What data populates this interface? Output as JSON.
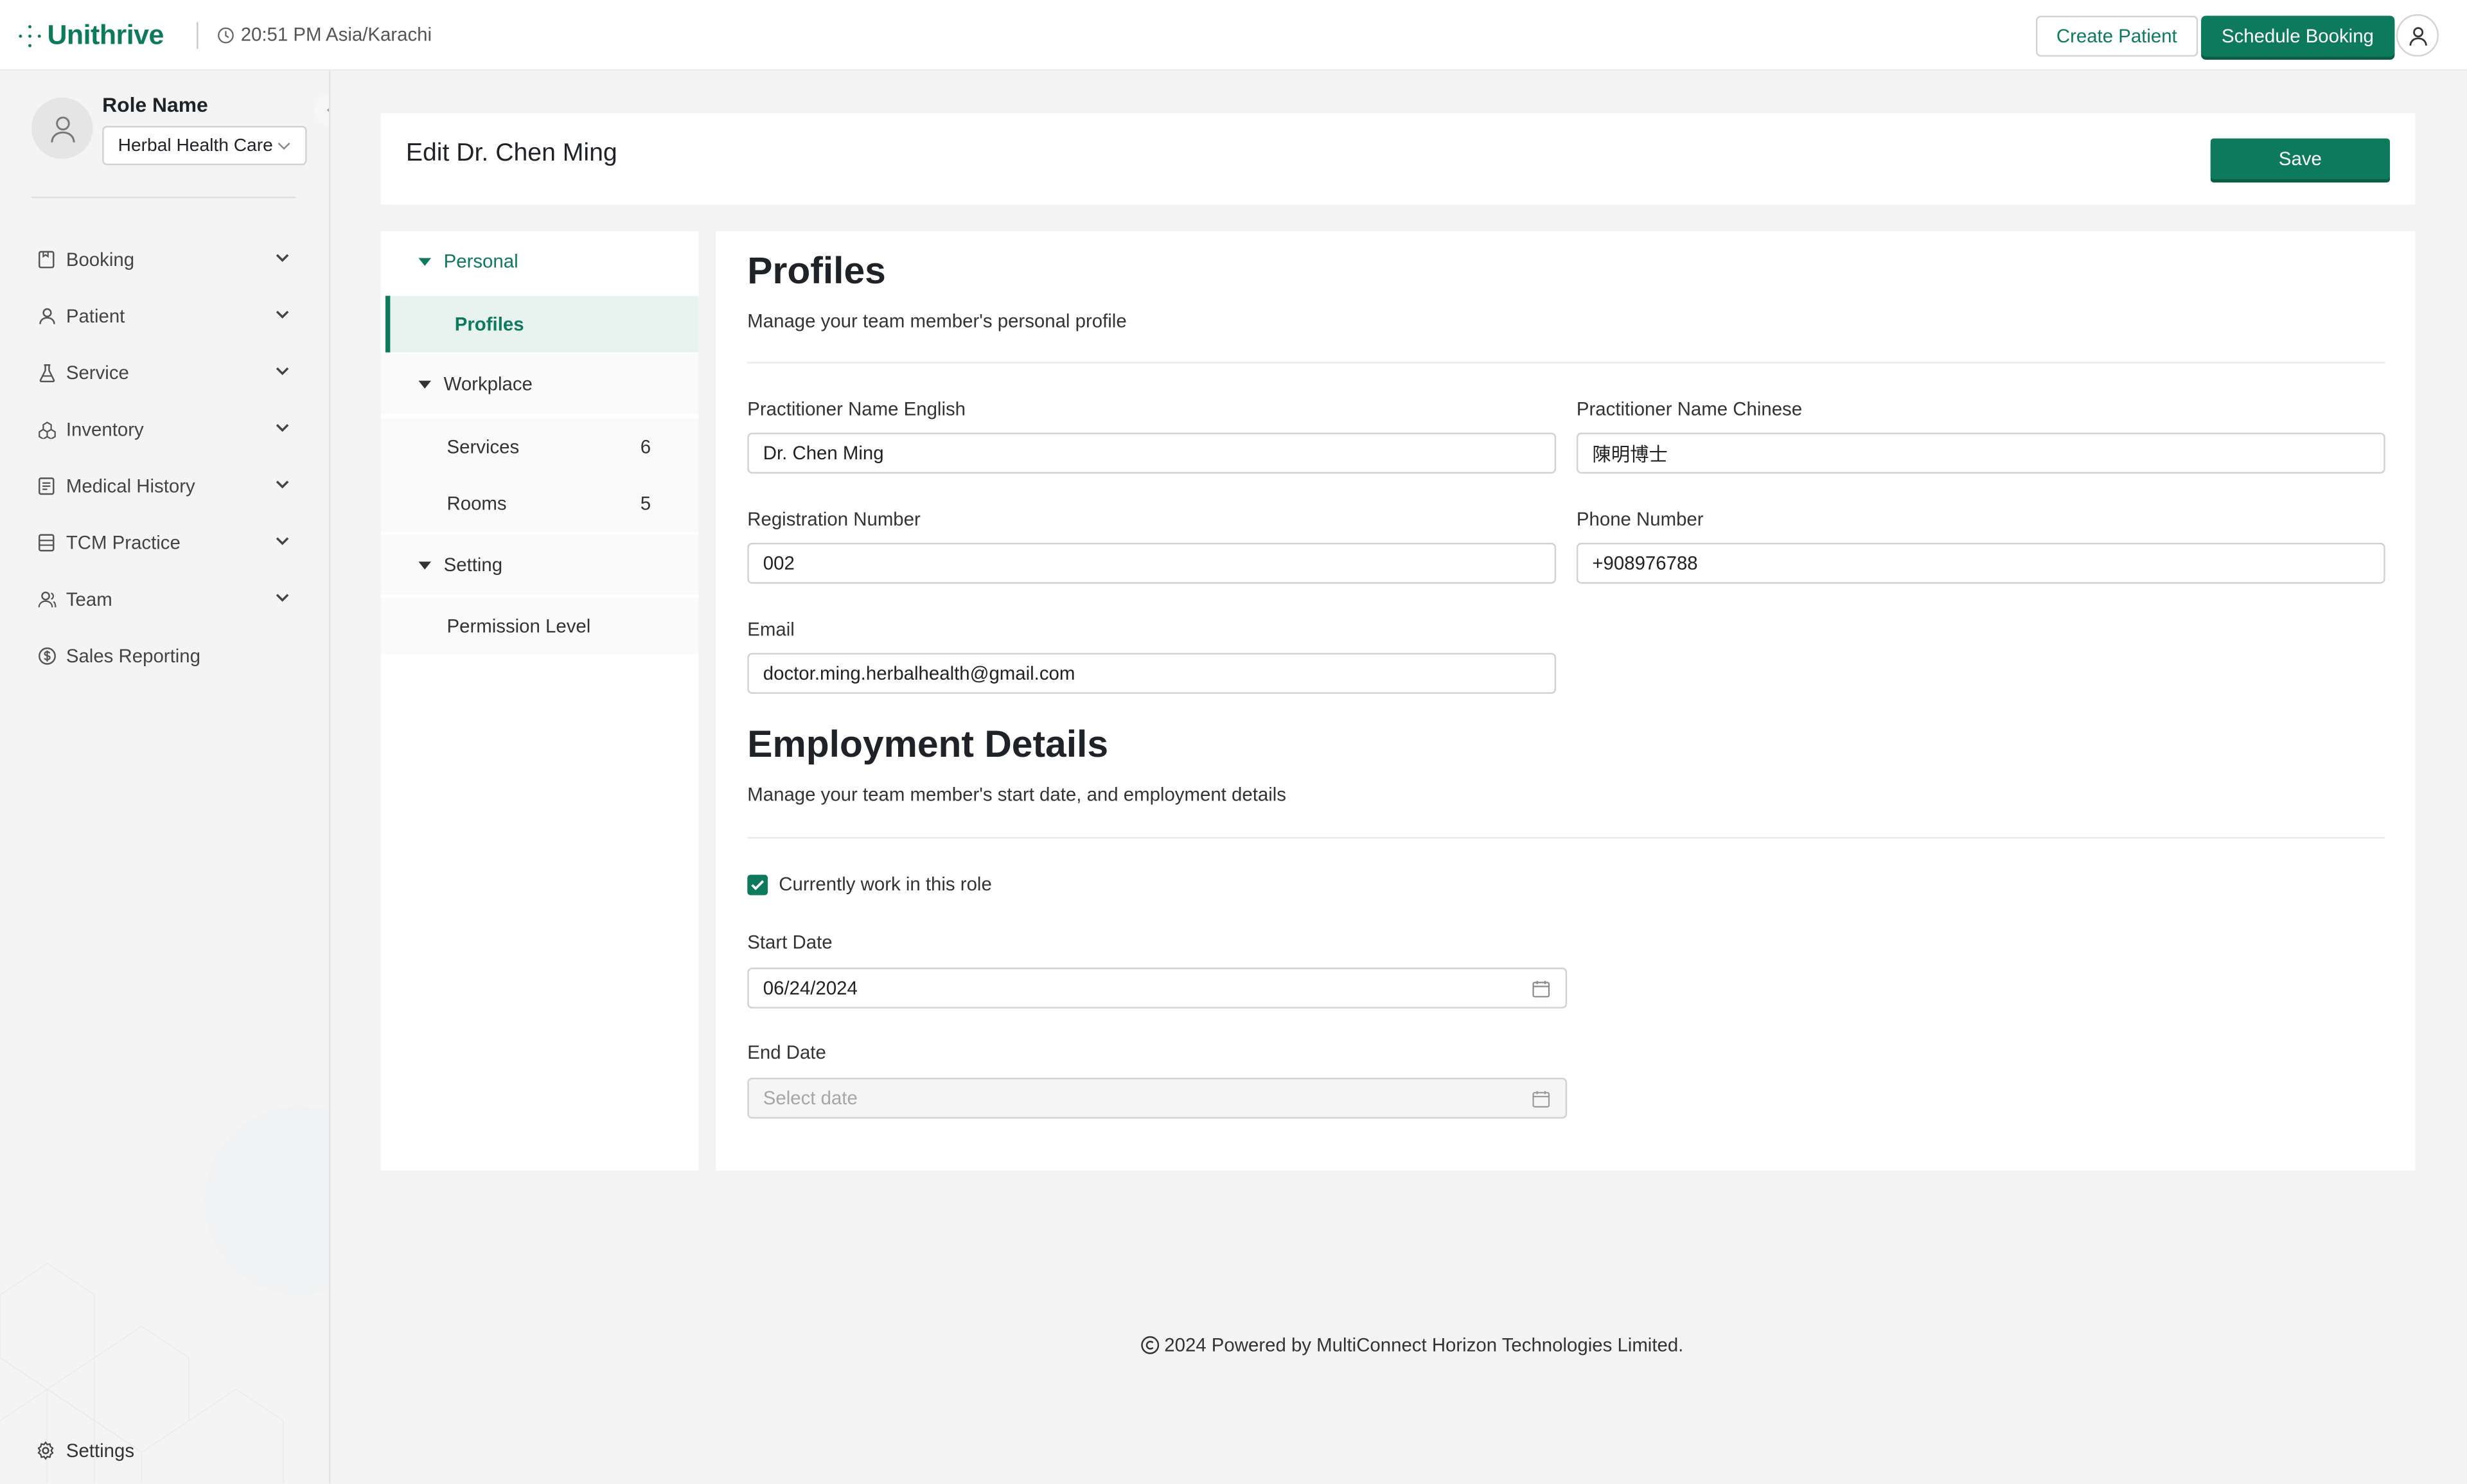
{
  "topbar": {
    "brand": "Unithrive",
    "time": "20:51 PM Asia/Karachi",
    "create_patient": "Create Patient",
    "schedule_booking": "Schedule Booking"
  },
  "sidebar": {
    "role_name": "Role Name",
    "clinic": "Herbal Health Care",
    "items": [
      {
        "label": "Booking",
        "icon": "booking-icon"
      },
      {
        "label": "Patient",
        "icon": "user-icon"
      },
      {
        "label": "Service",
        "icon": "flask-icon"
      },
      {
        "label": "Inventory",
        "icon": "inventory-icon"
      },
      {
        "label": "Medical History",
        "icon": "medical-history-icon"
      },
      {
        "label": "TCM Practice",
        "icon": "practice-icon"
      },
      {
        "label": "Team",
        "icon": "team-icon"
      },
      {
        "label": "Sales Reporting",
        "icon": "dollar-icon"
      }
    ],
    "settings": "Settings"
  },
  "header": {
    "title": "Edit Dr. Chen Ming",
    "save": "Save"
  },
  "subnav": {
    "personal": "Personal",
    "profiles": "Profiles",
    "workplace": "Workplace",
    "services": "Services",
    "services_count": "6",
    "rooms": "Rooms",
    "rooms_count": "5",
    "setting": "Setting",
    "permission_level": "Permission Level"
  },
  "profiles": {
    "title": "Profiles",
    "subtitle": "Manage your team member's personal profile",
    "name_en_label": "Practitioner Name English",
    "name_en_value": "Dr. Chen Ming",
    "name_zh_label": "Practitioner Name Chinese",
    "name_zh_value": "陳明博士",
    "reg_label": "Registration Number",
    "reg_value": "002",
    "phone_label": "Phone Number",
    "phone_value": "+908976788",
    "email_label": "Email",
    "email_value": "doctor.ming.herbalhealth@gmail.com"
  },
  "employment": {
    "title": "Employment Details",
    "subtitle": "Manage your team member's start date, and employment details",
    "current_role_label": "Currently work in this role",
    "current_role_checked": true,
    "start_label": "Start Date",
    "start_value": "06/24/2024",
    "end_label": "End Date",
    "end_placeholder": "Select date"
  },
  "footer": {
    "text": "2024 Powered by MultiConnect Horizon Technologies Limited."
  },
  "colors": {
    "brand": "#0e7a5c",
    "selected_bg": "#e8f3ef"
  }
}
